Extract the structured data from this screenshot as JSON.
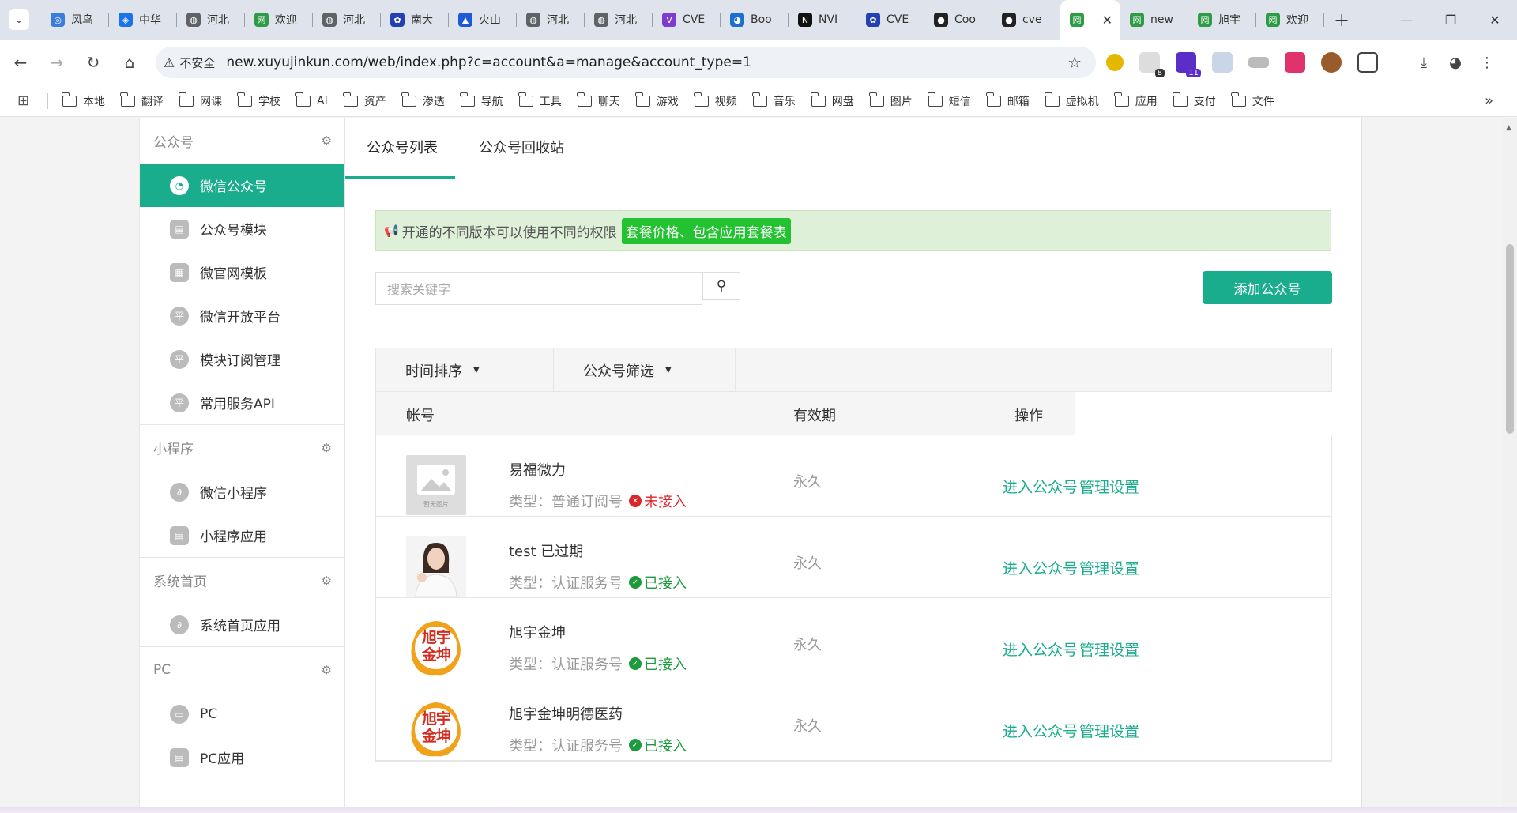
{
  "browser": {
    "tabs": [
      {
        "label": "风鸟",
        "color": "#3b7ddd",
        "glyph": "◎"
      },
      {
        "label": "中华",
        "color": "#1a73e8",
        "glyph": "◈"
      },
      {
        "label": "河北",
        "color": "#5f6368",
        "glyph": "◍"
      },
      {
        "label": "欢迎",
        "color": "#2e9b46",
        "glyph": "网"
      },
      {
        "label": "河北",
        "color": "#5f6368",
        "glyph": "◍"
      },
      {
        "label": "南大",
        "color": "#2440b3",
        "glyph": "✿"
      },
      {
        "label": "火山",
        "color": "#1c5ad8",
        "glyph": "▲"
      },
      {
        "label": "河北",
        "color": "#5f6368",
        "glyph": "◍"
      },
      {
        "label": "河北",
        "color": "#5f6368",
        "glyph": "◍"
      },
      {
        "label": "CVE",
        "color": "#7e3bd0",
        "glyph": "V"
      },
      {
        "label": "Boo",
        "color": "#1a6fd0",
        "glyph": "◕"
      },
      {
        "label": "NVI",
        "color": "#111111",
        "glyph": "N"
      },
      {
        "label": "CVE",
        "color": "#2440b3",
        "glyph": "✿"
      },
      {
        "label": "Coo",
        "color": "#222222",
        "glyph": "●"
      },
      {
        "label": "cve",
        "color": "#222222",
        "glyph": "●"
      },
      {
        "label": "",
        "color": "#2e9b46",
        "glyph": "网",
        "active": true
      },
      {
        "label": "new",
        "color": "#2e9b46",
        "glyph": "网"
      },
      {
        "label": "旭宇",
        "color": "#2e9b46",
        "glyph": "网"
      },
      {
        "label": "欢迎",
        "color": "#2e9b46",
        "glyph": "网"
      }
    ],
    "insecure_label": "不安全",
    "url": "new.xuyujinkun.com/web/index.php?c=account&a=manage&account_type=1",
    "ext_badges": {
      "ext2": "8",
      "ext3": "11"
    },
    "bookmarks": [
      "本地",
      "翻译",
      "网课",
      "学校",
      "AI",
      "资产",
      "渗透",
      "导航",
      "工具",
      "聊天",
      "游戏",
      "视频",
      "音乐",
      "网盘",
      "图片",
      "短信",
      "邮箱",
      "虚拟机",
      "应用",
      "支付",
      "文件"
    ]
  },
  "sidebar": {
    "sections": [
      {
        "title": "公众号",
        "items": [
          {
            "label": "微信公众号",
            "active": true,
            "icon": "wechat-icon"
          },
          {
            "label": "公众号模块",
            "icon": "bag-icon"
          },
          {
            "label": "微官网模板",
            "icon": "template-icon"
          },
          {
            "label": "微信开放平台",
            "icon": "ping-icon"
          },
          {
            "label": "模块订阅管理",
            "icon": "ping-icon"
          },
          {
            "label": "常用服务API",
            "icon": "ping-icon"
          }
        ]
      },
      {
        "title": "小程序",
        "items": [
          {
            "label": "微信小程序",
            "icon": "miniprogram-icon"
          },
          {
            "label": "小程序应用",
            "icon": "bag-icon"
          }
        ]
      },
      {
        "title": "系统首页",
        "items": [
          {
            "label": "系统首页应用",
            "icon": "miniprogram-icon"
          }
        ]
      },
      {
        "title": "PC",
        "items": [
          {
            "label": "PC",
            "icon": "monitor-icon"
          },
          {
            "label": "PC应用",
            "icon": "bag-icon"
          }
        ]
      }
    ]
  },
  "main": {
    "tabs": [
      "公众号列表",
      "公众号回收站"
    ],
    "notice_text": "开通的不同版本可以使用不同的权限",
    "notice_link": "套餐价格、包含应用套餐表",
    "search_placeholder": "搜索关键字",
    "add_button": "添加公众号",
    "filters": [
      "时间排序",
      "公众号筛选"
    ],
    "headers": {
      "account": "帐号",
      "validity": "有效期",
      "actions": "操作"
    },
    "rows": [
      {
        "name": "易福微力",
        "type_label": "类型：",
        "type": "普通订阅号",
        "status": "未接入",
        "status_ok": false,
        "validity": "永久",
        "thumb": "placeholder",
        "thumb_text": "暂无图片"
      },
      {
        "name": "test 已过期",
        "type_label": "类型：",
        "type": "认证服务号",
        "status": "已接入",
        "status_ok": true,
        "validity": "永久",
        "thumb": "person"
      },
      {
        "name": "旭宇金坤",
        "type_label": "类型：",
        "type": "认证服务号",
        "status": "已接入",
        "status_ok": true,
        "validity": "永久",
        "thumb": "logo",
        "logo_text": "旭宇金坤"
      },
      {
        "name": "旭宇金坤明德医药",
        "type_label": "类型：",
        "type": "认证服务号",
        "status": "已接入",
        "status_ok": true,
        "validity": "永久",
        "thumb": "logo",
        "logo_text": "旭宇金坤"
      }
    ],
    "action_enter": "进入公众号",
    "action_manage": "管理设置"
  }
}
